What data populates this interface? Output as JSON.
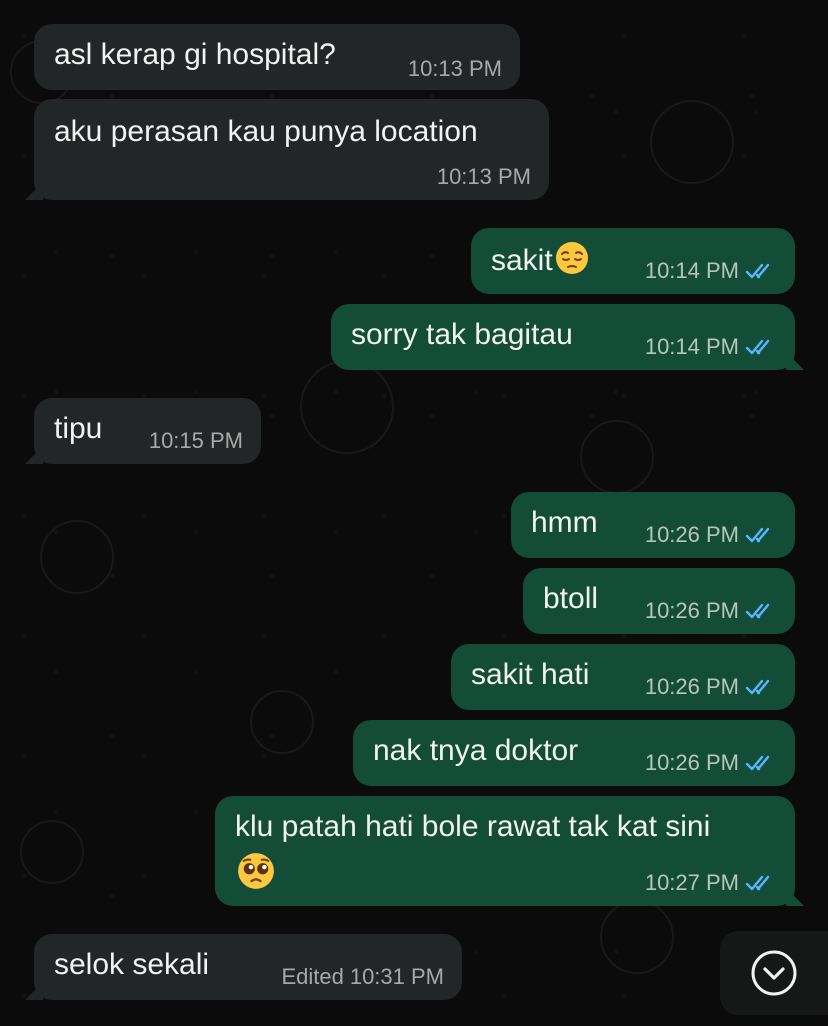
{
  "chat": {
    "messages": [
      {
        "direction": "incoming",
        "text": "asl kerap gi hospital?",
        "time": "10:13 PM"
      },
      {
        "direction": "incoming",
        "text": "aku perasan kau punya location",
        "time": "10:13 PM"
      },
      {
        "direction": "outgoing",
        "text": "sakit",
        "emoji": "pensive-face",
        "time": "10:14 PM",
        "status": "read"
      },
      {
        "direction": "outgoing",
        "text": "sorry tak bagitau",
        "time": "10:14 PM",
        "status": "read"
      },
      {
        "direction": "incoming",
        "text": "tipu",
        "time": "10:15 PM"
      },
      {
        "direction": "outgoing",
        "text": "hmm",
        "time": "10:26 PM",
        "status": "read"
      },
      {
        "direction": "outgoing",
        "text": "btoll",
        "time": "10:26 PM",
        "status": "read"
      },
      {
        "direction": "outgoing",
        "text": "sakit hati",
        "time": "10:26 PM",
        "status": "read"
      },
      {
        "direction": "outgoing",
        "text": "nak tnya doktor",
        "time": "10:26 PM",
        "status": "read"
      },
      {
        "direction": "outgoing",
        "text": "klu patah hati bole rawat tak kat sini",
        "emoji": "pleading-face",
        "time": "10:27 PM",
        "status": "read"
      },
      {
        "direction": "incoming",
        "text": "selok sekali",
        "edited_label": "Edited",
        "time": "10:31 PM"
      }
    ]
  },
  "scroll_button": {
    "icon": "chevron-down-icon"
  },
  "colors": {
    "background": "#0b0b0b",
    "incoming_bubble": "#232626",
    "outgoing_bubble": "#134d37",
    "read_ticks": "#58b6ff"
  }
}
